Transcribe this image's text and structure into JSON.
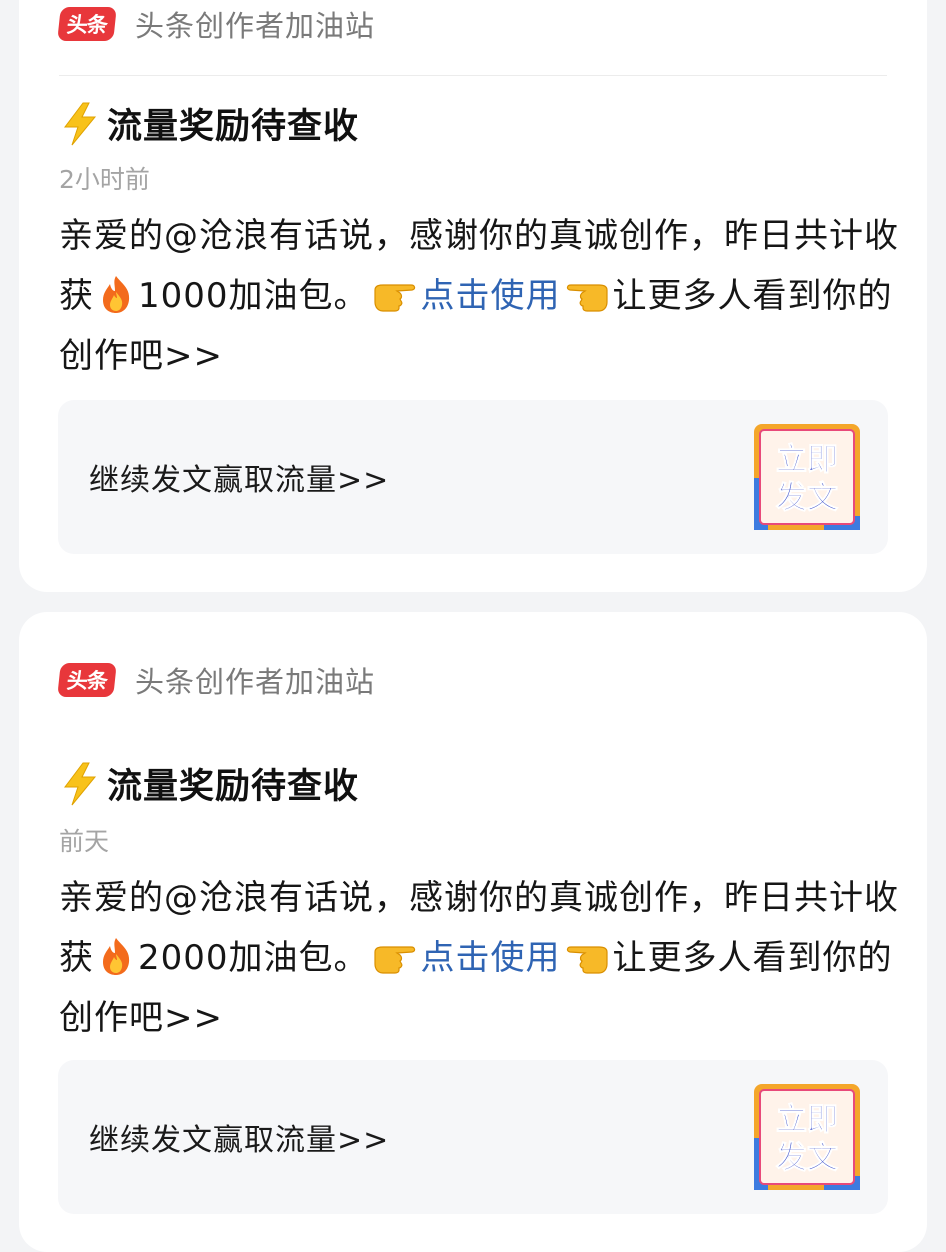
{
  "brand": {
    "logo_text": "头条",
    "source_name": "头条创作者加油站",
    "logo_color": "#e8373b"
  },
  "messages": [
    {
      "title": "流量奖励待查收",
      "time": "2小时前",
      "body_prefix": "亲爱的@沧浪有话说，感谢你的真诚创作，昨日共计收获",
      "amount": "1000加油包。",
      "link_text": "点击使用",
      "body_suffix": "让更多人看到你的创作吧>>",
      "action_label": "继续发文赢取流量>>",
      "badge_line1": "立即",
      "badge_line2": "发文"
    },
    {
      "title": "流量奖励待查收",
      "time": "前天",
      "body_prefix": "亲爱的@沧浪有话说，感谢你的真诚创作，昨日共计收获",
      "amount": "2000加油包。",
      "link_text": "点击使用",
      "body_suffix": "让更多人看到你的创作吧>>",
      "action_label": "继续发文赢取流量>>",
      "badge_line1": "立即",
      "badge_line2": "发文"
    }
  ],
  "icons": {
    "title_icon": "lightning-bolt-icon",
    "fire": "fire-icon",
    "hand_right": "pointing-right-hand-icon",
    "hand_left": "pointing-left-hand-icon"
  },
  "colors": {
    "link": "#2f64b3",
    "page_bg": "#f3f4f6",
    "card_bg": "#ffffff",
    "badge_frame": "#f4a62a",
    "badge_text": "#2a3fc6"
  }
}
